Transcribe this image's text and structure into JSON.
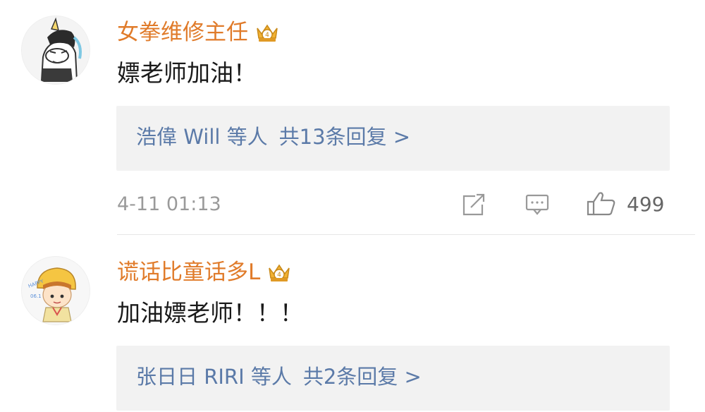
{
  "comments": [
    {
      "username": "女拳维修主任",
      "text": "嫖老师加油！",
      "reply_users": "浩偉 Will 等人",
      "reply_count": "共13条回复 >",
      "timestamp": "4-11 01:13",
      "like_count": "499"
    },
    {
      "username": "谎话比童话多L",
      "text": "加油嫖老师！！！",
      "reply_users": "张日日 RIRI 等人",
      "reply_count": "共2条回复 >"
    }
  ],
  "colors": {
    "username": "#e07b2a",
    "reply_link": "#5b7aa8",
    "meta_gray": "#9a9a9a",
    "reply_bg": "#f2f2f2"
  }
}
